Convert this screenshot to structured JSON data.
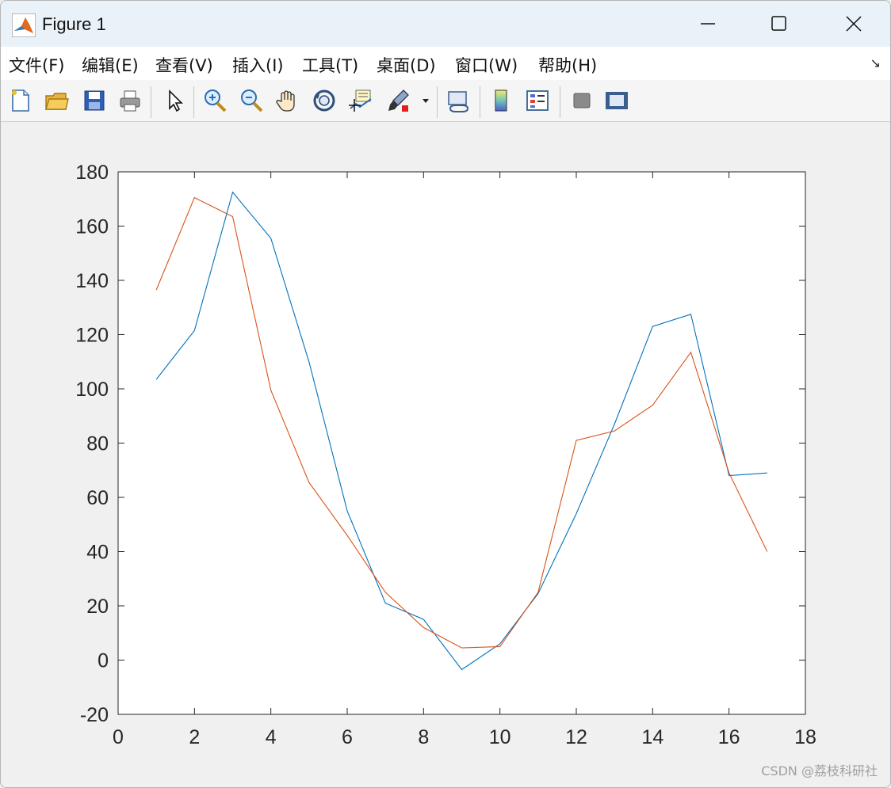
{
  "window": {
    "title": "Figure 1",
    "controls": {
      "minimize": "minimize",
      "maximize": "maximize",
      "close": "close"
    }
  },
  "menubar": {
    "items": [
      {
        "label": "文件(F)"
      },
      {
        "label": "编辑(E)"
      },
      {
        "label": "查看(V)"
      },
      {
        "label": "插入(I)"
      },
      {
        "label": "工具(T)"
      },
      {
        "label": "桌面(D)"
      },
      {
        "label": "窗口(W)"
      },
      {
        "label": "帮助(H)"
      }
    ],
    "dock_icon": "dock-arrow-icon"
  },
  "toolbar": {
    "buttons": [
      {
        "icon": "new-figure-icon"
      },
      {
        "icon": "open-folder-icon"
      },
      {
        "icon": "save-icon"
      },
      {
        "icon": "print-icon"
      },
      {
        "icon": "select-arrow-icon"
      },
      {
        "icon": "zoom-in-icon"
      },
      {
        "icon": "zoom-out-icon"
      },
      {
        "icon": "pan-hand-icon"
      },
      {
        "icon": "rotate-3d-icon"
      },
      {
        "icon": "data-cursor-icon"
      },
      {
        "icon": "brush-icon"
      },
      {
        "icon": "link-plot-icon"
      },
      {
        "icon": "colorbar-icon"
      },
      {
        "icon": "legend-icon"
      },
      {
        "icon": "hide-plot-tools-icon"
      },
      {
        "icon": "show-plot-tools-icon"
      }
    ]
  },
  "watermark": "CSDN @荔枝科研社",
  "colors": {
    "series1": "#0072bd",
    "series2": "#d95319",
    "axes_bg": "#ffffff",
    "figure_bg": "#f0f0f0"
  },
  "chart_data": {
    "type": "line",
    "title": "",
    "xlabel": "",
    "ylabel": "",
    "xlim": [
      0,
      18
    ],
    "ylim": [
      -20,
      180
    ],
    "xticks": [
      0,
      2,
      4,
      6,
      8,
      10,
      12,
      14,
      16,
      18
    ],
    "yticks": [
      -20,
      0,
      20,
      40,
      60,
      80,
      100,
      120,
      140,
      160,
      180
    ],
    "grid": false,
    "legend": "none",
    "x": [
      1,
      2,
      3,
      4,
      5,
      6,
      7,
      8,
      9,
      10,
      11,
      12,
      13,
      14,
      15,
      16,
      17
    ],
    "series": [
      {
        "color": "#0072bd",
        "values": [
          103.5,
          121.5,
          172.5,
          155.5,
          110,
          55,
          21,
          15,
          -3.5,
          6,
          24.5,
          54,
          87,
          123,
          127.5,
          68,
          69
        ]
      },
      {
        "color": "#d95319",
        "values": [
          136.5,
          170.5,
          163.5,
          99.5,
          65.5,
          46,
          25,
          12,
          4.5,
          5,
          25,
          81,
          84.5,
          94,
          113.5,
          69,
          40
        ]
      }
    ]
  }
}
